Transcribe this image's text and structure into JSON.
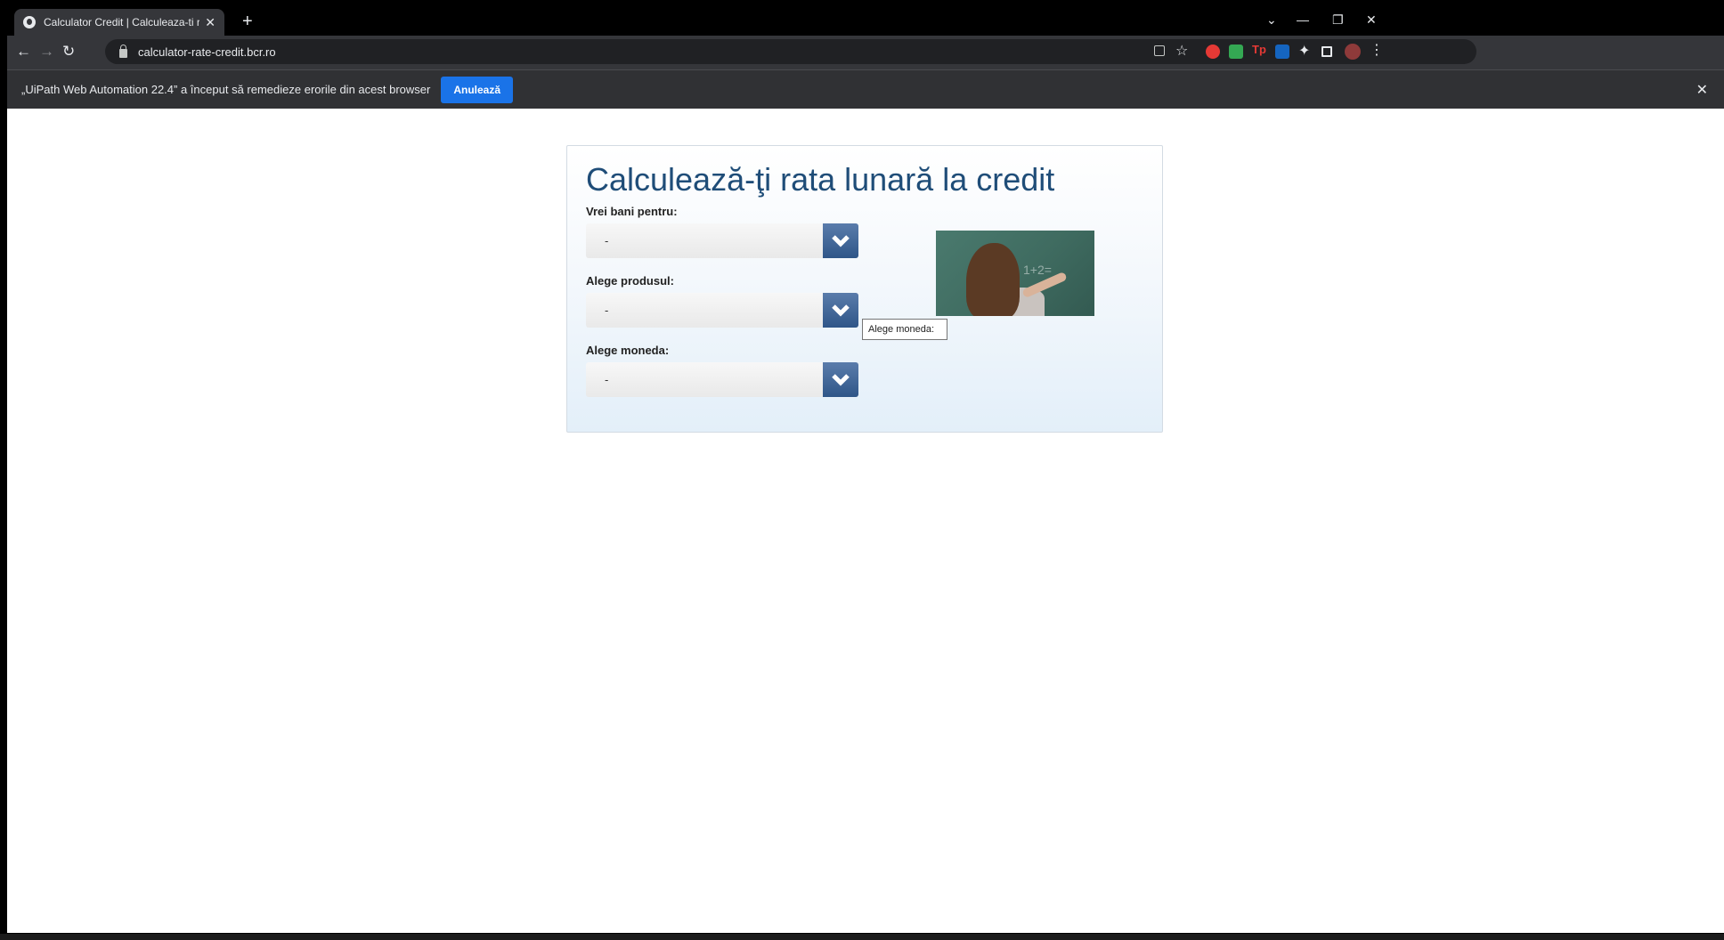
{
  "browser": {
    "tab_title": "Calculator Credit | Calculeaza-ti r",
    "new_tab": "+",
    "url": "calculator-rate-credit.bcr.ro",
    "nav": {
      "back": "←",
      "forward": "→",
      "reload": "↻"
    },
    "window_controls": {
      "tab_search": "⌄",
      "minimize": "—",
      "restore": "❐",
      "close": "✕"
    }
  },
  "infobar": {
    "message": "„UiPath Web Automation 22.4” a început să remedieze erorile din acest browser",
    "cancel_label": "Anulează",
    "close": "✕"
  },
  "calculator": {
    "title": "Calculează-ţi rata lunară la credit",
    "fields": [
      {
        "label": "Vrei bani pentru:",
        "value": "-"
      },
      {
        "label": "Alege produsul:",
        "value": "-"
      },
      {
        "label": "Alege moneda:",
        "value": "-"
      }
    ],
    "image_text": "1+2="
  },
  "tooltip": "Alege moneda:",
  "toolbar_icons": [
    "share-icon",
    "star-icon",
    "extension-red-icon",
    "extension-green-icon",
    "extension-tp-icon",
    "extension-ui-icon",
    "puzzle-icon",
    "sidepanel-icon",
    "avatar-icon",
    "menu-icon"
  ],
  "colors": {
    "title": "#1f4d78",
    "dropdown_arrow": "#2f5688",
    "cancel_button": "#1a73e8"
  }
}
